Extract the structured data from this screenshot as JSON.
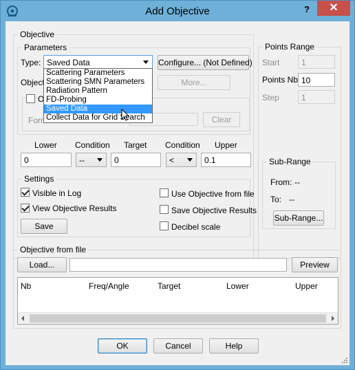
{
  "window": {
    "title": "Add Objective",
    "help_label": "?",
    "close_label": "✕",
    "app_icon": "cst-logo-icon"
  },
  "objective": {
    "group_label": "Objective",
    "parameters": {
      "group_label": "Parameters",
      "type_label": "Type:",
      "type_value": "Saved Data",
      "configure_label": "Configure... (Not Defined)",
      "objective_label": "Objecti",
      "more_label": "More...",
      "o_label": "O",
      "form_label": "Form",
      "clear_label": "Clear",
      "type_options": [
        "Scattering Parameters",
        "Scattering SMN Parameters",
        "Radiation Pattern",
        "FD-Probing",
        "Saved Data",
        "Collect Data for Grid Search"
      ],
      "selected_index": 4
    },
    "limits": {
      "lower_label": "Lower",
      "condition1_label": "Condition",
      "target_label": "Target",
      "condition2_label": "Condition",
      "upper_label": "Upper",
      "lower_value": "0",
      "condition1_value": "--",
      "target_value": "0",
      "condition2_value": "<",
      "upper_value": "0.1"
    },
    "settings": {
      "group_label": "Settings",
      "visible_in_log": "Visible in Log",
      "view_results": "View Objective Results",
      "save_label": "Save",
      "use_from_file": "Use Objective from file",
      "save_results": "Save Objective Results",
      "decibel_scale": "Decibel scale",
      "visible_in_log_checked": true,
      "view_results_checked": true,
      "use_from_file_checked": false,
      "save_results_checked": false,
      "decibel_scale_checked": false
    }
  },
  "points_range": {
    "group_label": "Points Range",
    "start_label": "Start",
    "start_value": "1",
    "points_label": "Points Nb",
    "points_value": "10",
    "step_label": "Step",
    "step_value": "1",
    "subrange": {
      "group_label": "Sub-Range",
      "from_label": "From:",
      "from_value": "--",
      "to_label": "To:",
      "to_value": "--",
      "button_label": "Sub-Range..."
    }
  },
  "objective_file": {
    "group_label": "Objective from file",
    "load_label": "Load...",
    "path_value": "",
    "preview_label": "Preview",
    "columns": [
      "Nb",
      "Freq/Angle",
      "Target",
      "Lower",
      "Upper"
    ]
  },
  "footer": {
    "ok_label": "OK",
    "cancel_label": "Cancel",
    "help_label": "Help"
  }
}
